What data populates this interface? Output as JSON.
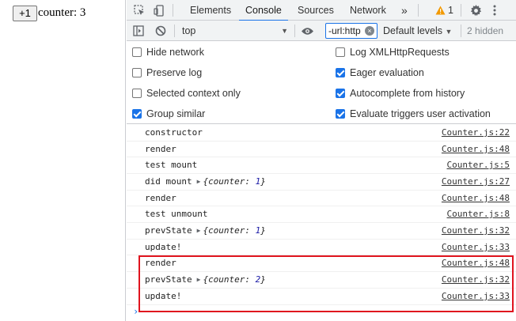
{
  "page": {
    "button_label": "+1",
    "counter_text": "counter: 3"
  },
  "devtools": {
    "tabs": [
      "Elements",
      "Console",
      "Sources",
      "Network"
    ],
    "more_tabs": "»",
    "warning_count": "1",
    "context": "top",
    "filter_value": "-url:http",
    "levels_label": "Default levels",
    "hidden_label": "2 hidden",
    "settings": {
      "hide_network": "Hide network",
      "preserve_log": "Preserve log",
      "selected_context": "Selected context only",
      "group_similar": "Group similar",
      "log_xhr": "Log XMLHttpRequests",
      "eager_eval": "Eager evaluation",
      "autocomplete": "Autocomplete from history",
      "eval_triggers": "Evaluate triggers user activation"
    },
    "checked": {
      "hide_network": false,
      "preserve_log": false,
      "selected_context": false,
      "group_similar": true,
      "log_xhr": false,
      "eager_eval": true,
      "autocomplete": true,
      "eval_triggers": true
    },
    "logs": [
      {
        "msg": "constructor",
        "obj": "",
        "src": "Counter.js:22"
      },
      {
        "msg": "render",
        "obj": "",
        "src": "Counter.js:48"
      },
      {
        "msg": "test mount",
        "obj": "",
        "src": "Counter.js:5"
      },
      {
        "msg": "did mount",
        "obj": "1",
        "src": "Counter.js:27"
      },
      {
        "msg": "render",
        "obj": "",
        "src": "Counter.js:48"
      },
      {
        "msg": "test unmount",
        "obj": "",
        "src": "Counter.js:8"
      },
      {
        "msg": "prevState",
        "obj": "1",
        "src": "Counter.js:32"
      },
      {
        "msg": "update!",
        "obj": "",
        "src": "Counter.js:33"
      },
      {
        "msg": "render",
        "obj": "",
        "src": "Counter.js:48"
      },
      {
        "msg": "prevState",
        "obj": "2",
        "src": "Counter.js:32"
      },
      {
        "msg": "update!",
        "obj": "",
        "src": "Counter.js:33"
      }
    ],
    "object_key": "counter",
    "prompt": "›"
  },
  "colors": {
    "accent": "#1a73e8",
    "highlight": "#e0141e",
    "warning": "#f29900"
  }
}
